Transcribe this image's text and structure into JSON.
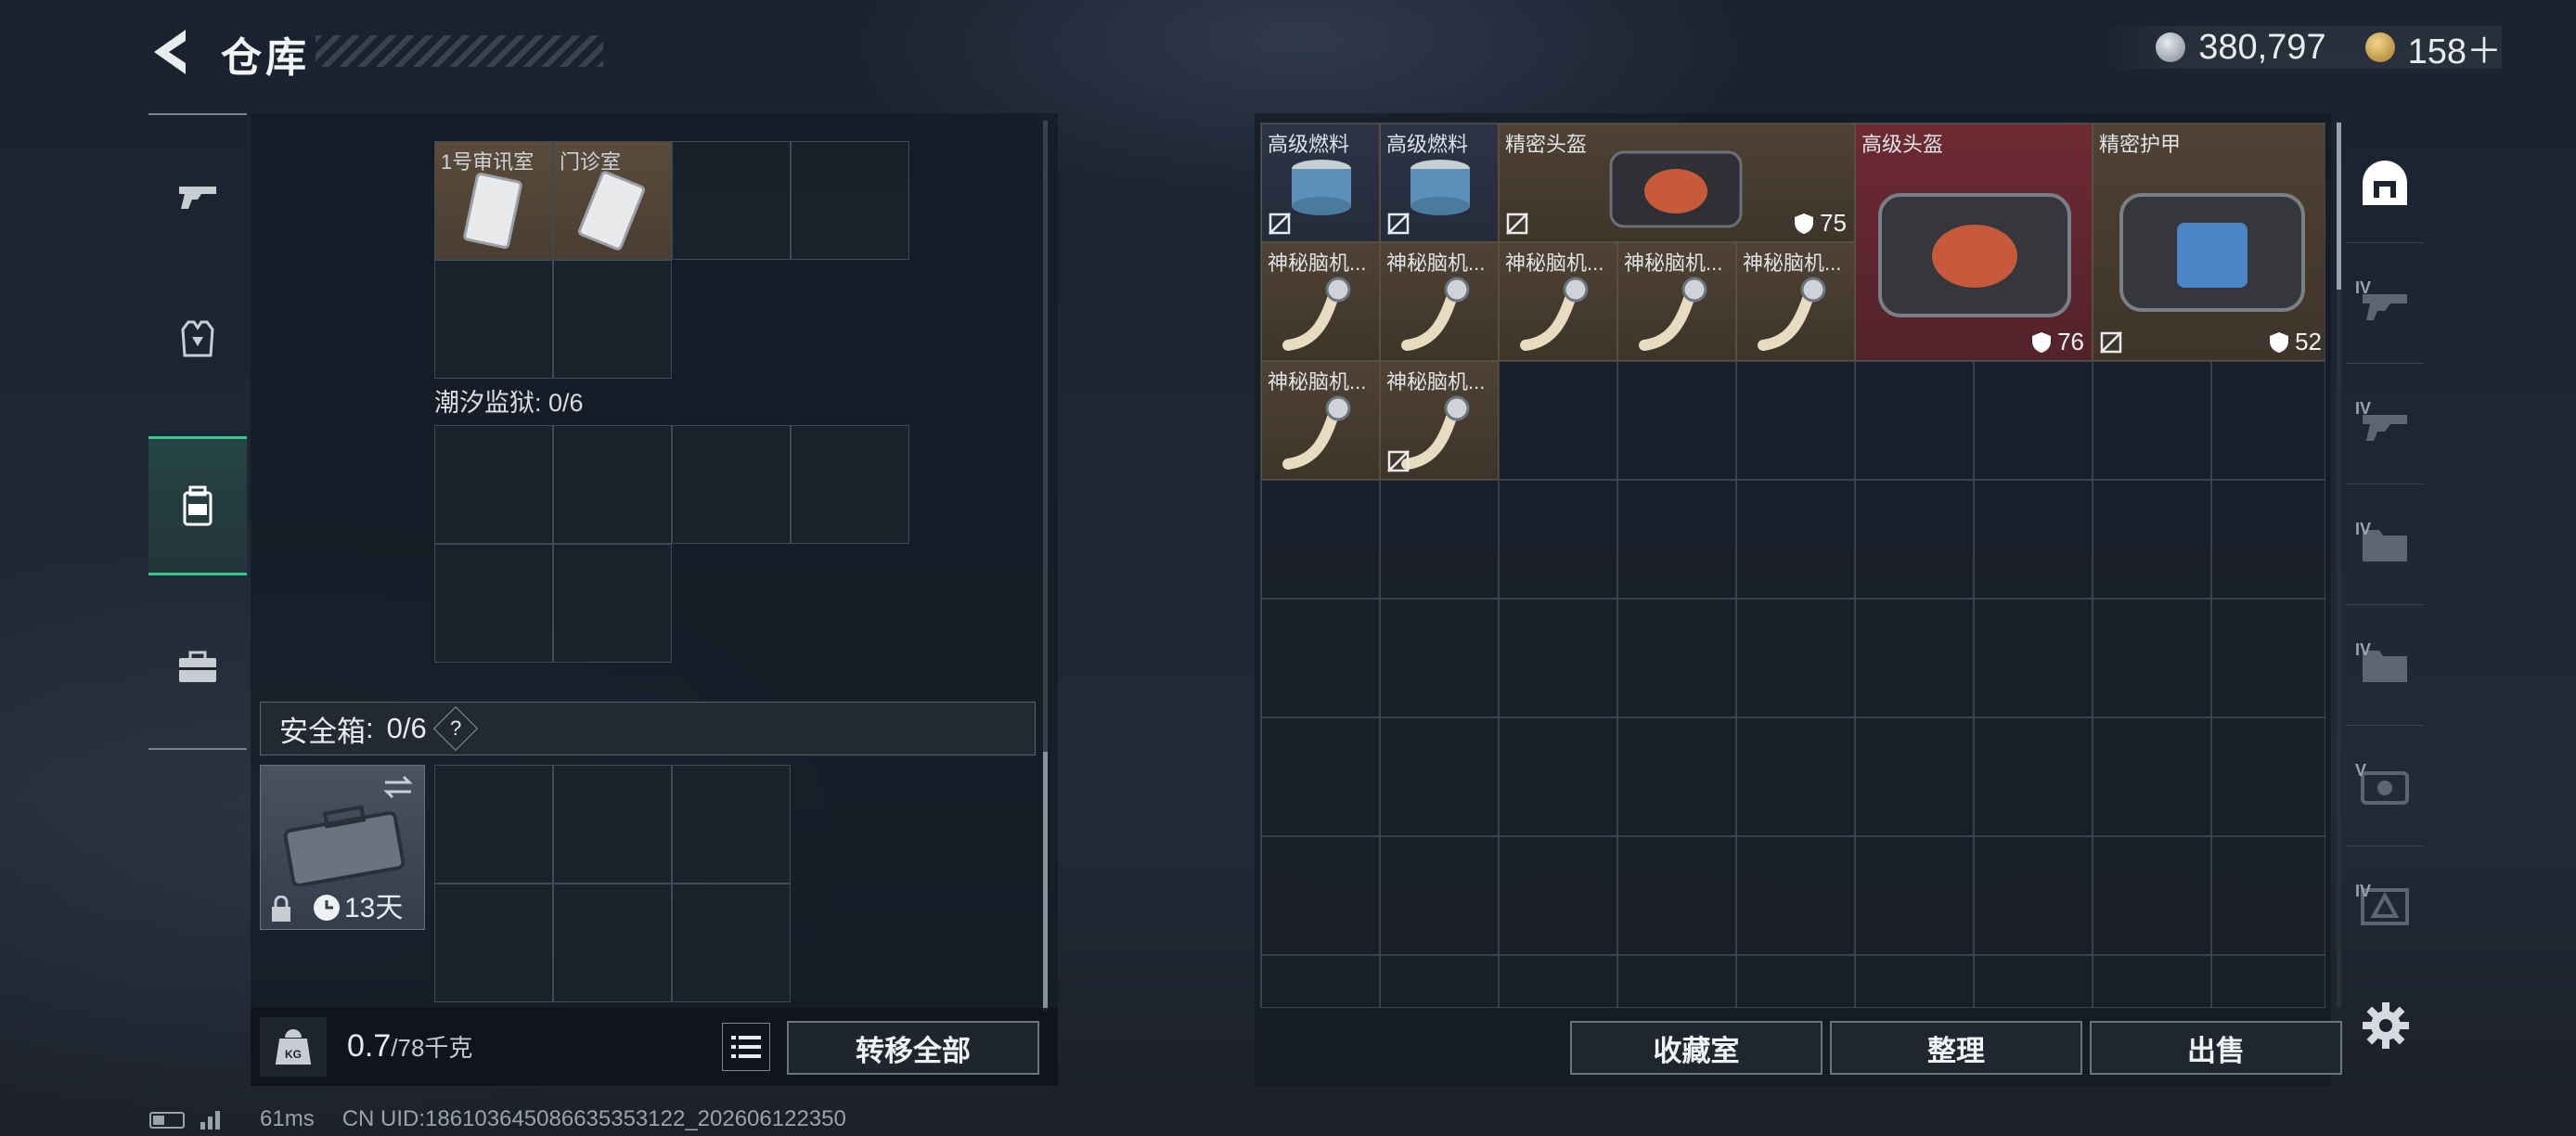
{
  "header": {
    "title": "仓库",
    "silver": "380,797",
    "gold": "158＋"
  },
  "left": {
    "top_items": [
      {
        "label": "1号审讯室"
      },
      {
        "label": "门诊室"
      }
    ],
    "section2": "潮汐监狱: 0/6",
    "safe_label": "安全箱",
    "safe_count": "0/6",
    "help": "?",
    "safe_time": "13天",
    "weight_value": "0.7",
    "weight_cap": "/78千克",
    "transfer_all": "转移全部"
  },
  "right": {
    "items": [
      {
        "label": "高级燃料"
      },
      {
        "label": "高级燃料"
      },
      {
        "label": "精密头盔",
        "dura": "75"
      },
      {
        "label": "高级头盔",
        "dura": "76"
      },
      {
        "label": "精密护甲",
        "dura": "52"
      },
      {
        "label": "神秘脑机..."
      },
      {
        "label": "神秘脑机..."
      },
      {
        "label": "神秘脑机..."
      },
      {
        "label": "神秘脑机..."
      },
      {
        "label": "神秘脑机..."
      },
      {
        "label": "神秘脑机..."
      },
      {
        "label": "神秘脑机..."
      }
    ],
    "tab_levels": [
      "IV",
      "IV",
      "IV",
      "IV",
      "V",
      "IV"
    ],
    "btn_collection": "收藏室",
    "btn_sort": "整理",
    "btn_sell": "出售"
  },
  "footer": {
    "ping": "61ms",
    "uid": "CN UID:18610364508663​5353122_202606122350"
  }
}
